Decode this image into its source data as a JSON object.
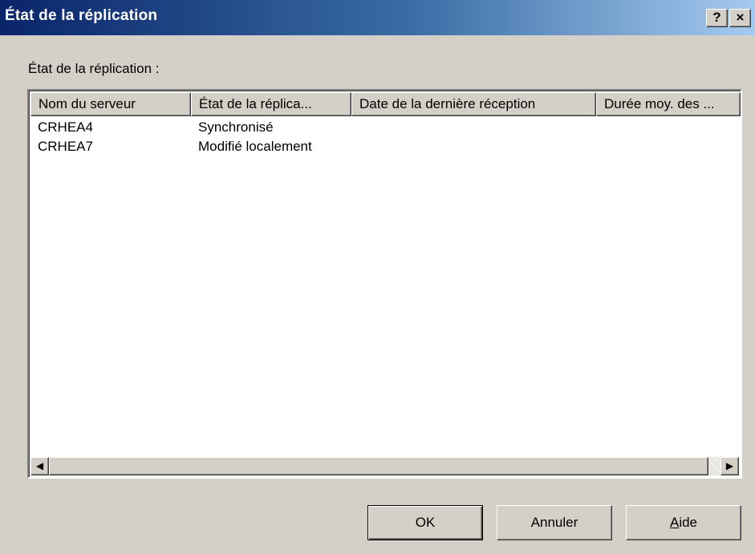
{
  "window": {
    "title": "État de la réplication",
    "help_glyph": "?",
    "close_glyph": "×"
  },
  "section_label": "État de la réplication :",
  "table": {
    "columns": [
      "Nom du serveur",
      "État de la réplica...",
      "Date de la dernière réception",
      "Durée moy. des ..."
    ],
    "rows": [
      [
        "CRHEA4",
        "Synchronisé",
        "",
        ""
      ],
      [
        "CRHEA7",
        "Modifié localement",
        "",
        ""
      ]
    ]
  },
  "scrollbar": {
    "left_arrow": "◀",
    "right_arrow": "▶"
  },
  "buttons": {
    "ok_label": "OK",
    "cancel_label": "Annuler",
    "help_label_first": "A",
    "help_label_rest": "ide"
  }
}
